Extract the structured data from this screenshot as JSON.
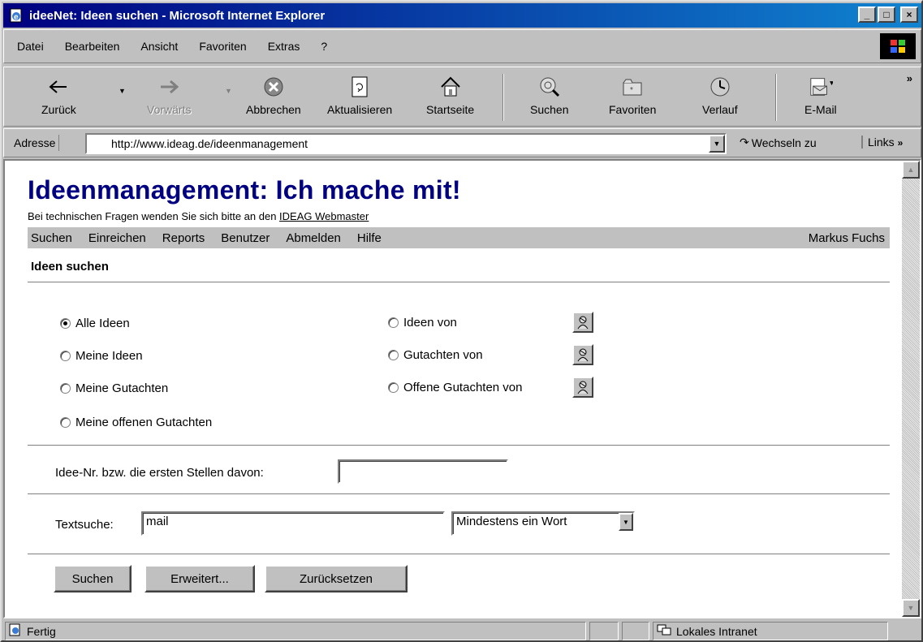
{
  "window": {
    "title": "ideeNet: Ideen suchen - Microsoft Internet Explorer",
    "buttons": [
      "_",
      "□",
      "×"
    ]
  },
  "menu": {
    "items": [
      {
        "label": "Datei"
      },
      {
        "label": "Bearbeiten"
      },
      {
        "label": "Ansicht"
      },
      {
        "label": "Favoriten"
      },
      {
        "label": "Extras"
      },
      {
        "label": "?"
      }
    ]
  },
  "toolbar": {
    "back": "Zurück",
    "forward": "Vorwärts",
    "stop": "Abbrechen",
    "refresh": "Aktualisieren",
    "home": "Startseite",
    "search": "Suchen",
    "favorites": "Favoriten",
    "history": "Verlauf",
    "mail": "E-Mail"
  },
  "address": {
    "label": "Adresse",
    "url": "http://www.ideag.de/ideenmanagement",
    "go": "Wechseln zu",
    "links": "Links"
  },
  "page": {
    "heading": "Ideenmanagement: Ich mache mit!",
    "support_text": "Bei technischen Fragen wenden Sie sich bitte an den",
    "support_link": "IDEAG Webmaster",
    "nav": [
      "Suchen",
      "Einreichen",
      "Reports",
      "Benutzer",
      "Abmelden",
      "Hilfe"
    ],
    "user": "Markus Fuchs",
    "section_title": "Ideen suchen",
    "radios_left": [
      {
        "label": "Alle Ideen",
        "checked": true
      },
      {
        "label": "Meine Ideen",
        "checked": false
      },
      {
        "label": "Meine Gutachten",
        "checked": false
      },
      {
        "label": "Meine offenen Gutachten",
        "checked": false
      }
    ],
    "radios_right": [
      {
        "label": "Ideen von",
        "checked": false
      },
      {
        "label": "Gutachten von",
        "checked": false
      },
      {
        "label": "Offene Gutachten von",
        "checked": false
      }
    ],
    "idea_no_label": "Idee-Nr. bzw. die ersten Stellen davon:",
    "idea_no_value": "",
    "textsearch_label": "Textsuche:",
    "textsearch_value": "mail",
    "match_mode": "Mindestens ein Wort",
    "btn_search": "Suchen",
    "btn_advanced": "Erweitert...",
    "btn_reset": "Zurücksetzen"
  },
  "status": {
    "text": "Fertig",
    "zone": "Lokales Intranet"
  }
}
